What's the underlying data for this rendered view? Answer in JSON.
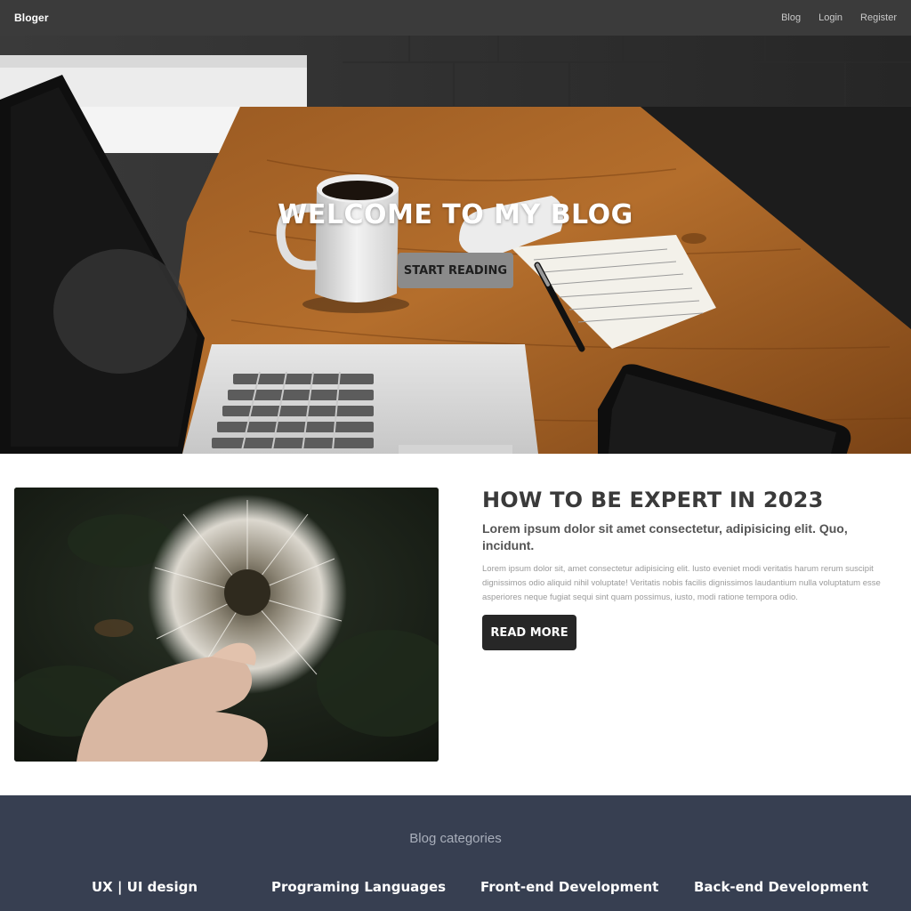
{
  "navbar": {
    "brand": "Bloger",
    "links": [
      "Blog",
      "Login",
      "Register"
    ]
  },
  "hero": {
    "title": "WELCOME TO MY BLOG",
    "button_label": "START READING"
  },
  "post": {
    "title": "HOW TO BE EXPERT IN 2023",
    "subtitle": "Lorem ipsum dolor sit amet consectetur, adipisicing elit. Quo, incidunt.",
    "body": "Lorem ipsum dolor sit, amet consectetur adipisicing elit. Iusto eveniet modi veritatis harum rerum suscipit dignissimos odio aliquid nihil voluptate! Veritatis nobis facilis dignissimos laudantium nulla voluptatum esse asperiores neque fugiat sequi sint quam possimus, iusto, modi ratione tempora odio.",
    "button_label": "READ MORE"
  },
  "categories": {
    "heading": "Blog categories",
    "items": [
      "UX | UI design",
      "Programing Languages",
      "Front-end Development",
      "Back-end Development"
    ]
  },
  "colors": {
    "navbar_bg": "#3b3b3b",
    "footer_bg": "#373f51",
    "read_more_bg": "#272727",
    "start_reading_bg": "#8b8b8b"
  }
}
